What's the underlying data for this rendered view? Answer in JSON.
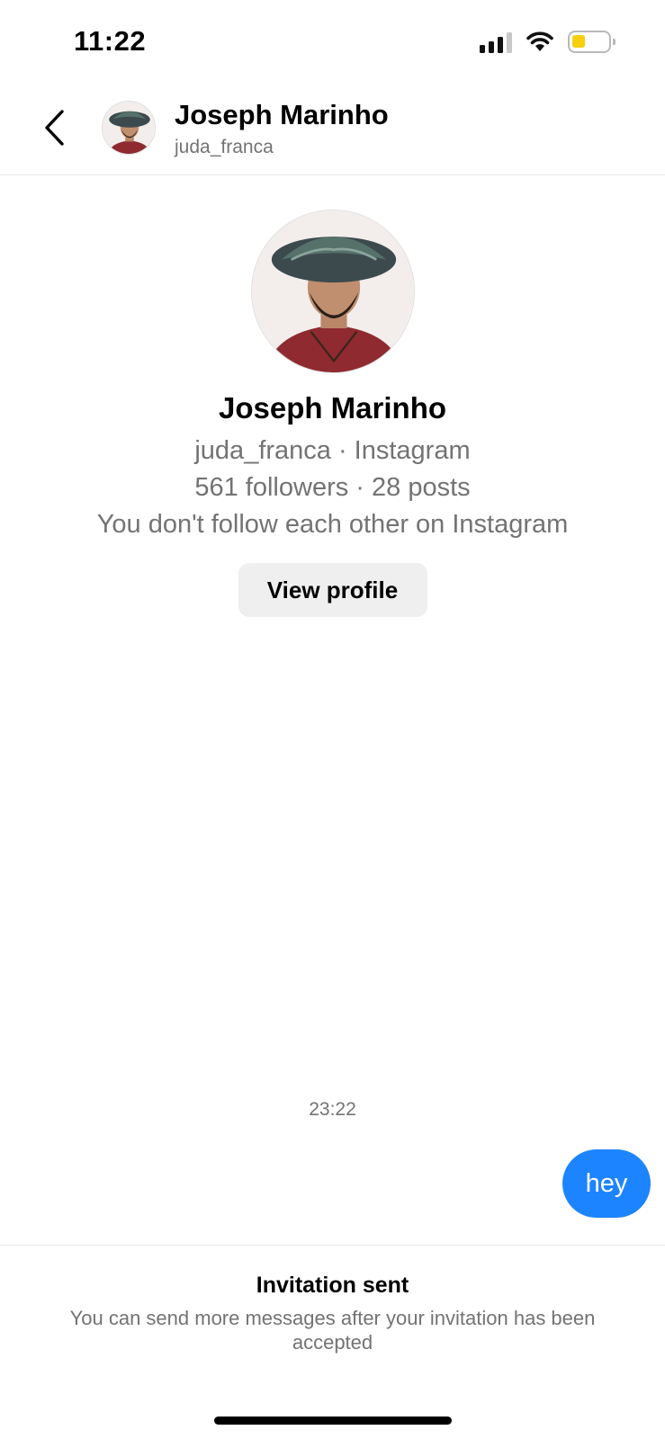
{
  "status_bar": {
    "time": "11:22",
    "battery_color": "#f7cf0f"
  },
  "header": {
    "back_icon": "chevron-left-icon",
    "name": "Joseph Marinho",
    "username": "juda_franca"
  },
  "profile": {
    "name": "Joseph Marinho",
    "handle_line": "juda_franca · Instagram",
    "stats_line": "561 followers · 28 posts",
    "relation_line": "You don't follow each other on Instagram",
    "view_profile_label": "View profile"
  },
  "messages": {
    "timestamp": "23:22",
    "items": [
      {
        "sender": "me",
        "text": "hey",
        "color": "#1d84ff"
      }
    ]
  },
  "invitation": {
    "title": "Invitation sent",
    "body": "You can send more messages after your invitation has been accepted"
  }
}
